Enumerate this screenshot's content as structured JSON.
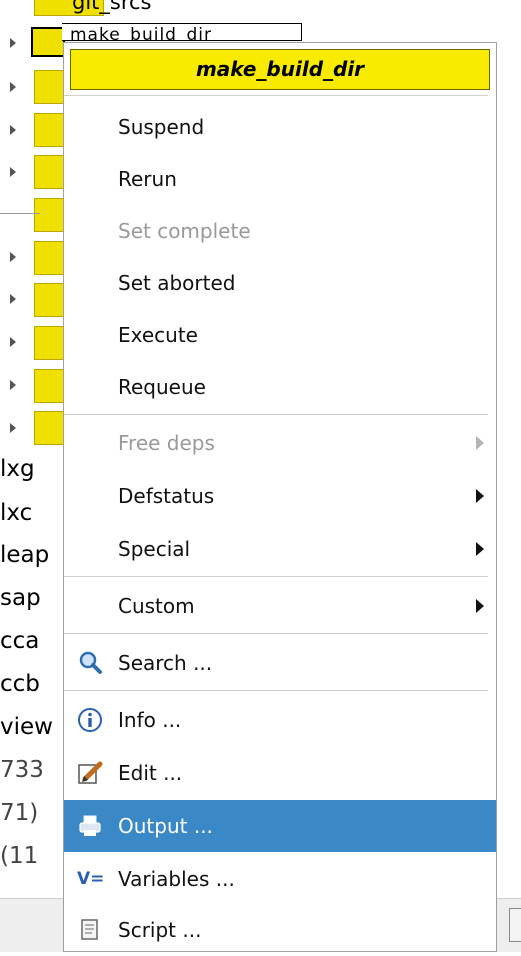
{
  "background": {
    "top_partial_label": "git_srcs",
    "selected_node_label": "make_build_dir",
    "truncated_rows": [
      "lxg",
      "lxc",
      "leap",
      "sap",
      "cca",
      "ccb",
      "view",
      "733",
      "71)",
      "(11"
    ]
  },
  "menu": {
    "title": "make_build_dir",
    "items": [
      {
        "label": "Suspend"
      },
      {
        "label": "Rerun"
      },
      {
        "label": "Set complete"
      },
      {
        "label": "Set aborted"
      },
      {
        "label": "Execute"
      },
      {
        "label": "Requeue"
      },
      {
        "label": "Free deps"
      },
      {
        "label": "Defstatus"
      },
      {
        "label": "Special"
      },
      {
        "label": "Custom"
      },
      {
        "label": "Search ...",
        "icon": "magnifier-icon"
      },
      {
        "label": "Info ...",
        "icon": "info-icon"
      },
      {
        "label": "Edit ...",
        "icon": "pencil-edit-icon"
      },
      {
        "label": "Output ...",
        "icon": "printer-output-icon"
      },
      {
        "label": "Variables ...",
        "icon": "variables-icon"
      },
      {
        "label": "Script ...",
        "icon": "script-document-icon"
      }
    ],
    "variables_icon_text": "V="
  },
  "colors": {
    "title_bg": "#f8eb00",
    "highlight": "#3a88c5",
    "node_yellow": "#f0e000"
  }
}
